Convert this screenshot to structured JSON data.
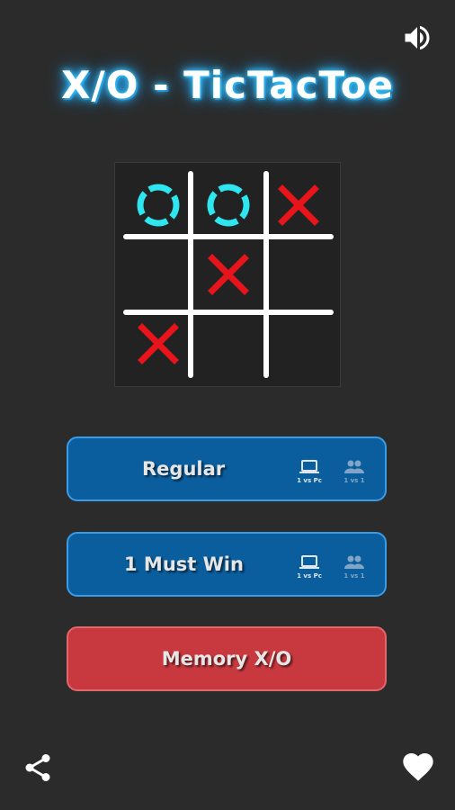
{
  "app": {
    "title": "X/O - TicTacToe"
  },
  "board": {
    "cells": [
      "O",
      "O",
      "X",
      "",
      "X",
      "",
      "X",
      "",
      ""
    ],
    "colors": {
      "x": "#e8141c",
      "o": "#2ee6ef",
      "grid": "#ffffff"
    }
  },
  "modes": [
    {
      "label": "Regular",
      "style": "blue",
      "options": [
        {
          "caption": "1 vs Pc",
          "icon": "laptop-icon",
          "state": "active"
        },
        {
          "caption": "1 vs 1",
          "icon": "people-icon",
          "state": "inactive"
        }
      ]
    },
    {
      "label": "1 Must Win",
      "style": "blue",
      "options": [
        {
          "caption": "1 vs Pc",
          "icon": "laptop-icon",
          "state": "active"
        },
        {
          "caption": "1 vs 1",
          "icon": "people-icon",
          "state": "inactive"
        }
      ]
    },
    {
      "label": "Memory X/O",
      "style": "red",
      "options": []
    }
  ],
  "colors": {
    "background": "#2b2b2b",
    "blue_button": "#0b5e9e",
    "red_button": "#c8393f"
  },
  "icons": {
    "sound": "volume-icon",
    "share": "share-icon",
    "favorite": "heart-icon"
  }
}
